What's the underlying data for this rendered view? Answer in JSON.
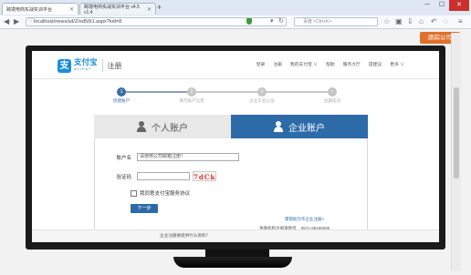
{
  "browser": {
    "tabs": [
      {
        "title": "跨境电商实战实训平台",
        "active": true
      },
      {
        "title": "跨境电商实战实训平台 v4.5 v1.4",
        "active": false
      }
    ],
    "url": "localhost/news/sd/Z/ed5/b1.aspx?kid=8",
    "search_placeholder": "百度 <Ctrl+K>"
  },
  "badge": {
    "label": "跟踪公司"
  },
  "alipay": {
    "logo_cn": "支付宝",
    "logo_en": "ALIPAY",
    "register": "注册",
    "nav": [
      "登录",
      "注册",
      "我的支付宝 ∨",
      "帮助",
      "服务大厅",
      "提建议",
      "更多 ∨"
    ]
  },
  "steps": [
    {
      "num": "1",
      "label": "创建账户",
      "active": true
    },
    {
      "num": "2",
      "label": "填写账户信息",
      "active": false
    },
    {
      "num": "3",
      "label": "企业实名认证",
      "active": false
    },
    {
      "num": "✓",
      "label": "注册成功",
      "active": false
    }
  ],
  "account_tabs": {
    "personal": "个人账户",
    "corporate": "企业账户"
  },
  "form": {
    "account_label": "账户名",
    "account_placeholder": "请使用公司邮箱注册！",
    "code_label": "验证码",
    "code_value": "",
    "captcha_text": "7dCk",
    "agree_text": "我同意支付宝服务协议",
    "next_button": "下一步"
  },
  "links": {
    "help": "需帮助写作企业注册>",
    "hotline_label": "金融机构注册请致电",
    "hotline": "0571-88158090"
  },
  "faq": {
    "text": "企业注册要提供什么资料？"
  },
  "colors": {
    "primary": "#2d6ba8",
    "badge": "#e07029",
    "alipay_blue": "#1a8fd8"
  }
}
